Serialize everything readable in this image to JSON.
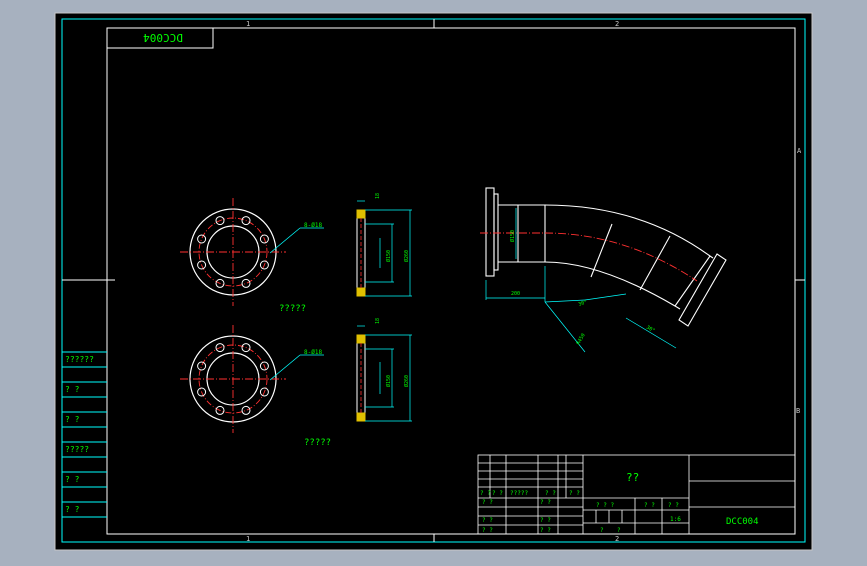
{
  "drawing": {
    "mirrored_title_tag": "DCC004",
    "drawing_number": "DCC004",
    "title_block_name": "??",
    "scale": "1:6",
    "zone_markers": {
      "top_mid": "1",
      "top_right": "2",
      "bottom_mid": "1",
      "bottom_right": "2",
      "right_upper": "A",
      "right_lower": "B"
    },
    "flange_top": {
      "caption": "?????",
      "hole_callout": "8-Ø18"
    },
    "flange_bottom": {
      "caption": "?????",
      "hole_callout": "8-Ø18"
    },
    "section_top": {
      "dim_top": "18",
      "dim_a": "Ø150",
      "dim_b": "Ø260"
    },
    "section_bottom": {
      "dim_top": "18",
      "dim_a": "Ø150",
      "dim_b": "Ø260"
    },
    "elbow": {
      "dim_left": "Ø150",
      "dim_bottom": "200",
      "angle_a": "30°",
      "angle_b": "30°",
      "radius": "R450"
    },
    "left_strip_labels": [
      "??????",
      "? ?",
      "? ?",
      "?????",
      "? ?",
      "? ?"
    ],
    "title_block_row_labels": [
      "? ?",
      "? ?",
      "?????",
      "? ?",
      "? ?"
    ],
    "title_block_left_labels": [
      "? ?",
      "? ?",
      "? ?"
    ],
    "title_block_mid_labels": [
      "? ?",
      "? ?",
      "? ?"
    ],
    "title_block_right_labels": [
      "? ? ?",
      "? ?",
      "? ?"
    ],
    "title_block_small": [
      "?",
      "?"
    ]
  },
  "colors": {
    "background": "#a7b1bf",
    "paper": "#000000",
    "border": "#ffffff",
    "frame_inner": "#00ffff",
    "dimension": "#00ffff",
    "centerline": "#ff0000",
    "text": "#00ff00"
  }
}
